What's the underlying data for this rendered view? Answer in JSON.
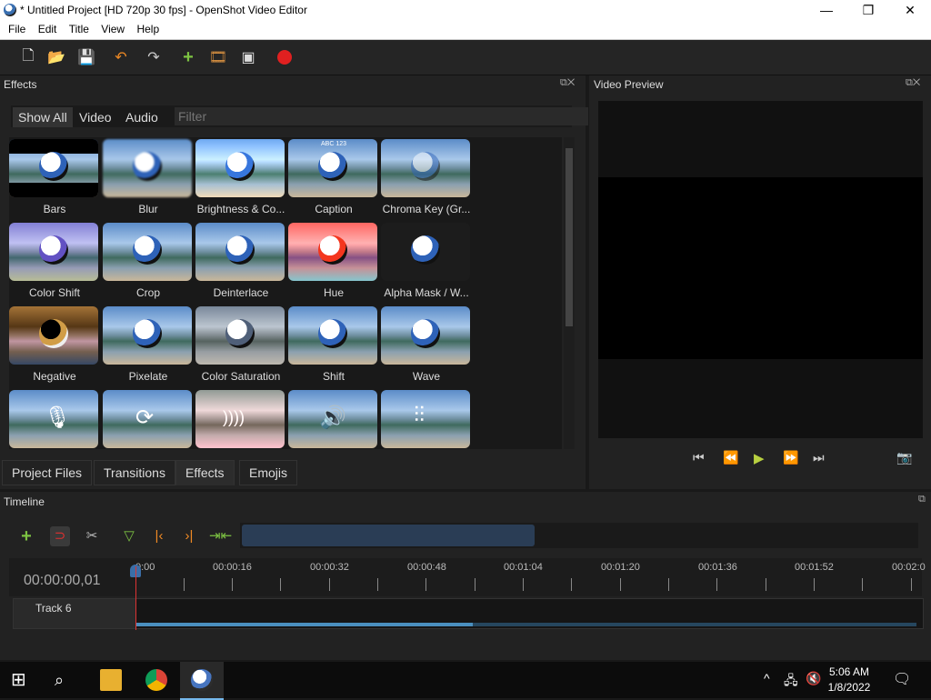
{
  "window": {
    "title": "* Untitled Project [HD 720p 30 fps] - OpenShot Video Editor",
    "minimize": "—",
    "maximize": "❐",
    "close": "✕"
  },
  "menu": [
    "File",
    "Edit",
    "Title",
    "View",
    "Help"
  ],
  "effects_panel": {
    "title": "Effects",
    "filter_tabs": [
      "Show All",
      "Video",
      "Audio"
    ],
    "filter_placeholder": "Filter",
    "items": [
      "Bars",
      "Blur",
      "Brightness & Co...",
      "Caption",
      "Chroma Key (Gr...",
      "Color Shift",
      "Crop",
      "Deinterlace",
      "Hue",
      "Alpha Mask / W...",
      "Negative",
      "Pixelate",
      "Color Saturation",
      "Shift",
      "Wave",
      "",
      "",
      "",
      "",
      ""
    ],
    "caption_thumb_text": "ABC 123"
  },
  "bottom_tabs": [
    "Project Files",
    "Transitions",
    "Effects",
    "Emojis"
  ],
  "preview_panel": {
    "title": "Video Preview"
  },
  "timeline": {
    "title": "Timeline",
    "timecode": "00:00:00,01",
    "ruler_labels": [
      "0:00",
      "00:00:16",
      "00:00:32",
      "00:00:48",
      "00:01:04",
      "00:01:20",
      "00:01:36",
      "00:01:52",
      "00:02:0"
    ],
    "track_name": "Track 6"
  },
  "taskbar": {
    "time": "5:06 AM",
    "date": "1/8/2022"
  }
}
